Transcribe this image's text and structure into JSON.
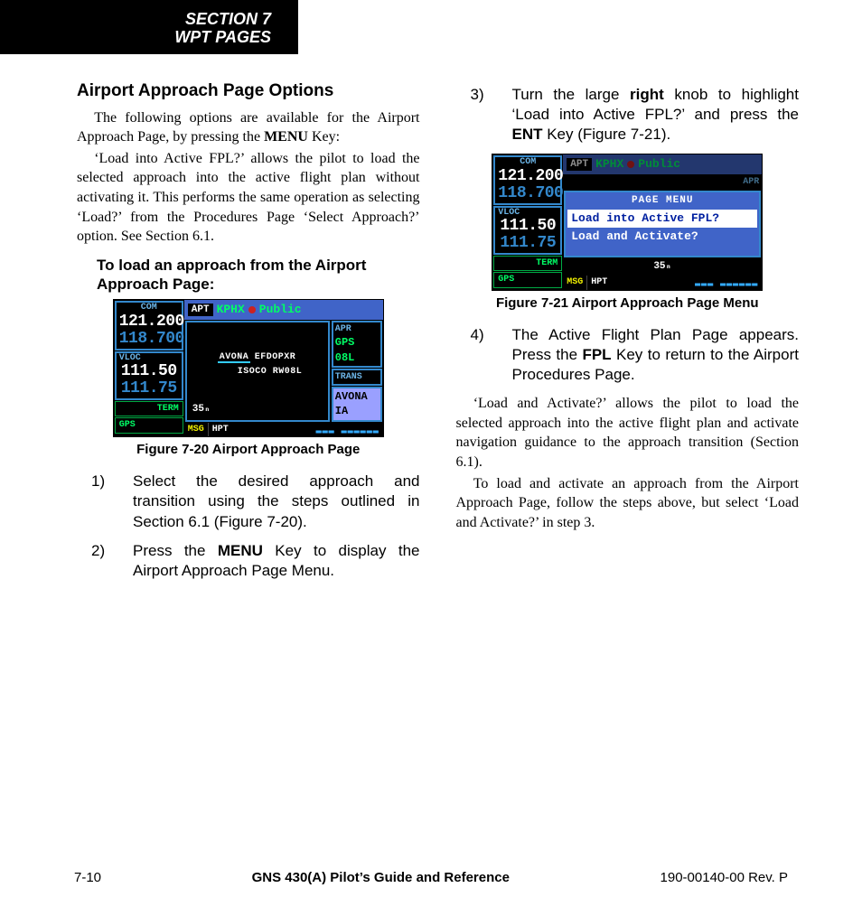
{
  "section_tab": {
    "line1": "SECTION 7",
    "line2": "WPT PAGES"
  },
  "left": {
    "heading": "Airport Approach Page Options",
    "p1a": "The following options are available for the Airport Approach Page, by pressing the ",
    "p1b_key": "MENU",
    "p1c": " Key:",
    "p2": "‘Load into Active FPL?’ allows the pilot to load the selected approach into the active flight plan without activating it.  This performs the same operation as selecting ‘Load?’ from the Procedures Page ‘Select Approach?’ option.  See Section 6.1.",
    "instr_head": "To load an approach from the Airport Approach Page:",
    "fig20_caption": "Figure 7-20  Airport Approach Page",
    "step1": "Select the desired approach and transition using the steps outlined in Section 6.1 (Figure 7-20).",
    "step2a": "Press the ",
    "step2b_key": "MENU",
    "step2c": " Key to display the Airport Approach Page Menu."
  },
  "right": {
    "step3a": "Turn the large ",
    "step3b_key": "right",
    "step3c": " knob to highlight ‘Load into Active FPL?’ and press the ",
    "step3d_key": "ENT",
    "step3e": " Key (Figure 7-21).",
    "fig21_caption": "Figure 7-21  Airport Approach Page Menu",
    "step4a": "The Active Flight Plan Page appears.  Press the ",
    "step4b_key": "FPL",
    "step4c": " Key to return to the Airport Procedures Page.",
    "p3": "‘Load and Activate?’ allows the pilot to load the selected approach into the active flight plan and activate navigation guidance to the approach transition (Section 6.1).",
    "p4": "To load and activate an approach from the Airport Approach Page, follow the steps above, but select ‘Load and Activate?’ in step 3."
  },
  "gps20": {
    "com_label": "COM",
    "com_active": "121.200",
    "com_standby": "118.700",
    "vloc_label": "VLOC",
    "vloc_active": "111.50",
    "vloc_standby": "111.75",
    "term": "TERM",
    "gps_label": "GPS",
    "apt_tag": "APT",
    "apt_code": "KPHX",
    "apt_public": "Public",
    "apr_label": "APR",
    "apr_val1": "GPS",
    "apr_val2": "08L",
    "trans_label": "TRANS",
    "trans_val": "AVONA IA",
    "map1": "AVONA EFDOPXR",
    "map2": "ISOCO RW08L",
    "scale": "35ₙ",
    "msg": "MSG",
    "hpt": "HPT",
    "bars": "▂▂▂ ▂▂▂▂▂▂"
  },
  "gps21": {
    "com_label": "COM",
    "com_active": "121.200",
    "com_standby": "118.700",
    "vloc_label": "VLOC",
    "vloc_active": "111.50",
    "vloc_standby": "111.75",
    "term": "TERM",
    "gps_label": "GPS",
    "apt_tag": "APT",
    "apt_code": "KPHX",
    "apt_public": "Public",
    "apr_label": "APR",
    "menu_title": "PAGE MENU",
    "menu_item1": "Load into Active FPL?",
    "menu_item2": "Load and Activate?",
    "under": "35ₙ",
    "msg": "MSG",
    "hpt": "HPT",
    "bars": "▂▂▂ ▂▂▂▂▂▂"
  },
  "footer": {
    "page": "7-10",
    "title": "GNS 430(A) Pilot’s Guide and Reference",
    "doc": "190-00140-00  Rev. P"
  }
}
